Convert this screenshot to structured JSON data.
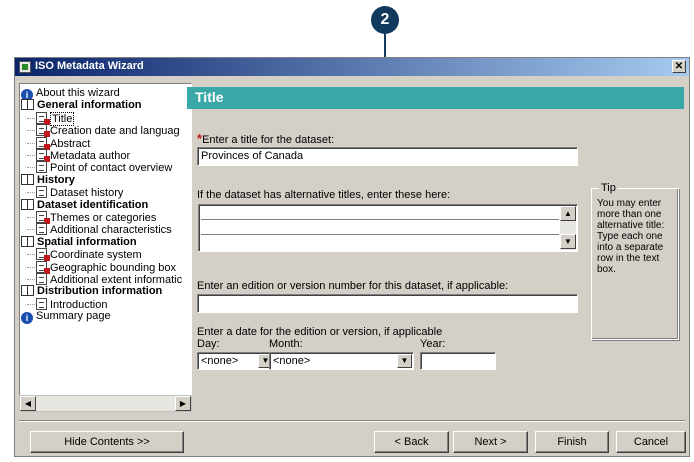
{
  "callout": {
    "number": "2"
  },
  "window": {
    "title": "ISO Metadata Wizard",
    "close_glyph": "✕"
  },
  "tree": {
    "items": [
      {
        "label": "About this wizard",
        "icon": "info-icon",
        "bold": false
      },
      {
        "label": "General information",
        "icon": "book-icon",
        "bold": true
      },
      {
        "label": "Title",
        "icon": "page-red-icon",
        "bold": false,
        "selected": true
      },
      {
        "label": "Creation date and languag",
        "icon": "page-red-icon",
        "bold": false
      },
      {
        "label": "Abstract",
        "icon": "page-red-icon",
        "bold": false
      },
      {
        "label": "Metadata author",
        "icon": "page-red-icon",
        "bold": false
      },
      {
        "label": "Point of contact overview",
        "icon": "page-icon",
        "bold": false
      },
      {
        "label": "History",
        "icon": "book-icon",
        "bold": true
      },
      {
        "label": "Dataset history",
        "icon": "page-icon",
        "bold": false
      },
      {
        "label": "Dataset identification",
        "icon": "book-icon",
        "bold": true
      },
      {
        "label": "Themes or categories",
        "icon": "page-red-icon",
        "bold": false
      },
      {
        "label": "Additional characteristics",
        "icon": "page-icon",
        "bold": false
      },
      {
        "label": "Spatial information",
        "icon": "book-icon",
        "bold": true
      },
      {
        "label": "Coordinate system",
        "icon": "page-red-icon",
        "bold": false
      },
      {
        "label": "Geographic bounding box",
        "icon": "page-red-icon",
        "bold": false
      },
      {
        "label": "Additional extent informatic",
        "icon": "page-icon",
        "bold": false
      },
      {
        "label": "Distribution information",
        "icon": "book-icon",
        "bold": true
      },
      {
        "label": "Introduction",
        "icon": "page-icon",
        "bold": false
      },
      {
        "label": "Summary page",
        "icon": "info-icon",
        "bold": false
      }
    ]
  },
  "panel": {
    "header": "Title",
    "title_label": "Enter a title for the dataset:",
    "title_required_marker": "*",
    "title_value": "Provinces of Canada",
    "alt_titles_label": "If the dataset has alternative titles, enter these here:",
    "edition_label": "Enter an edition or version number for this dataset, if applicable:",
    "edition_value": "",
    "date_label": "Enter a date for the edition or version, if applicable",
    "day_label": "Day:",
    "day_value": "<none>",
    "month_label": "Month:",
    "month_value": "<none>",
    "year_label": "Year:",
    "year_value": ""
  },
  "tip": {
    "title": "Tip",
    "text": "You may enter more than one alternative title: Type each one into a separate row in the text box."
  },
  "buttons": {
    "hide_contents": "Hide Contents >>",
    "back": "< Back",
    "next": "Next >",
    "finish": "Finish",
    "cancel": "Cancel"
  }
}
